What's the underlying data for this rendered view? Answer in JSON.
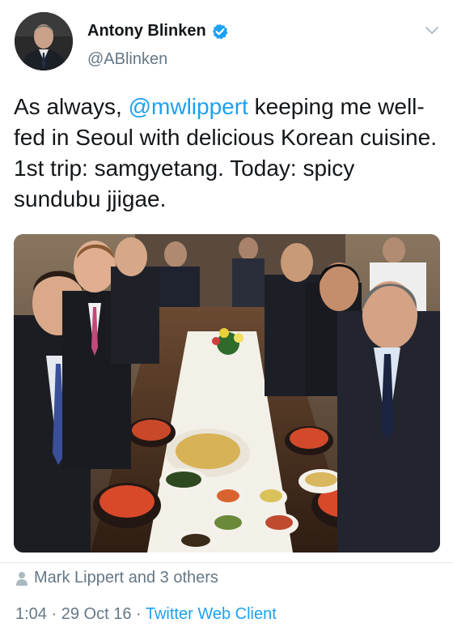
{
  "user": {
    "display_name": "Antony Blinken",
    "handle": "@ABlinken",
    "verified": true
  },
  "tweet": {
    "text_prefix": "As always, ",
    "mention": "@mwlippert",
    "text_suffix": " keeping me well-fed in Seoul with delicious Korean cuisine. 1st trip: samgyetang. Today: spicy sundubu jjigae."
  },
  "engagement": {
    "liked_by": "Mark Lippert and 3 others"
  },
  "meta": {
    "time": "1:04",
    "separator1": " · ",
    "date": "29 Oct 16",
    "separator2": " · ",
    "client": "Twitter Web Client"
  },
  "colors": {
    "link": "#1da1f2",
    "secondary_text": "#657786",
    "primary_text": "#14171a"
  },
  "icons": [
    "verified-badge-icon",
    "chevron-down-icon",
    "person-icon"
  ]
}
